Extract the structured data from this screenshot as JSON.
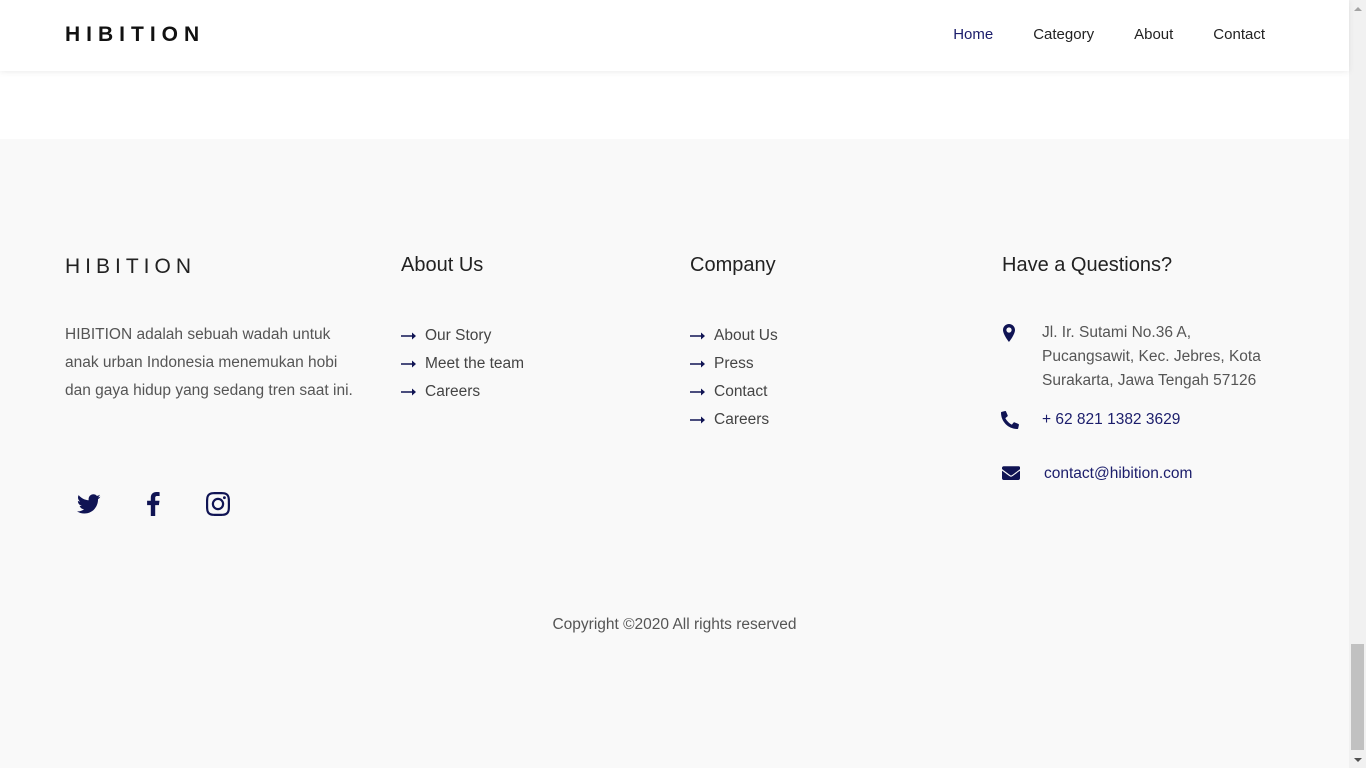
{
  "navbar": {
    "brand": "HIBITION",
    "links": [
      {
        "label": "Home",
        "active": true
      },
      {
        "label": "Category",
        "active": false
      },
      {
        "label": "About",
        "active": false
      },
      {
        "label": "Contact",
        "active": false
      }
    ]
  },
  "footer": {
    "brand": "HIBITION",
    "description": "HIBITION adalah sebuah wadah untuk anak urban Indonesia menemukan hobi dan gaya hidup yang sedang tren saat ini.",
    "social": [
      "twitter-icon",
      "facebook-icon",
      "instagram-icon"
    ],
    "about": {
      "heading": "About Us",
      "links": [
        "Our Story",
        "Meet the team",
        "Careers"
      ]
    },
    "company": {
      "heading": "Company",
      "links": [
        "About Us",
        "Press",
        "Contact",
        "Careers"
      ]
    },
    "contact": {
      "heading": "Have a Questions?",
      "address": "Jl. Ir. Sutami No.36 A, Pucangsawit, Kec. Jebres, Kota Surakarta, Jawa Tengah 57126",
      "phone": "+ 62 821 1382 3629",
      "email": "contact@hibition.com"
    },
    "copyright": "Copyright ©2020 All rights reserved"
  },
  "colors": {
    "accent": "#1b1d6b",
    "icon": "#101454",
    "footer_bg": "#f9f9f9"
  }
}
